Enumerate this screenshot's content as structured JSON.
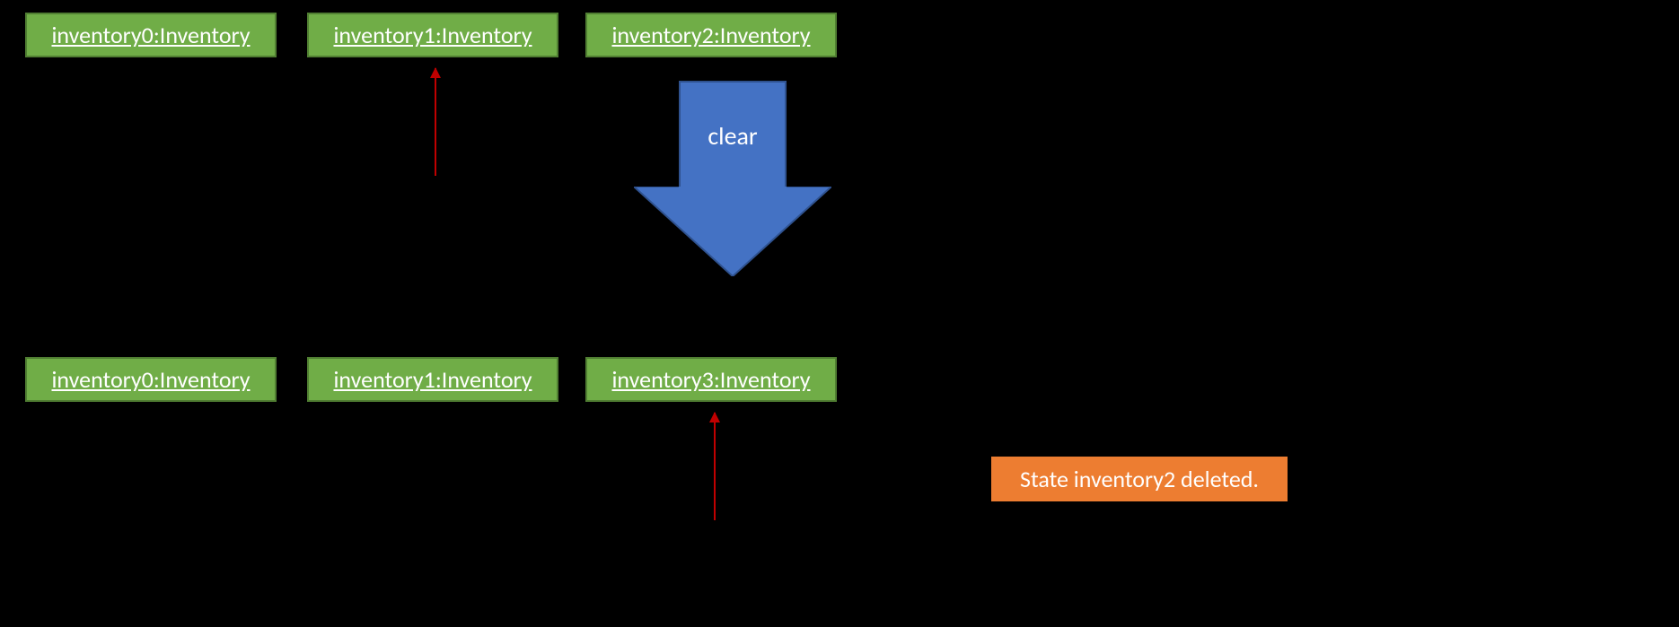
{
  "top_row": {
    "objects": [
      {
        "label": "inventory0:Inventory"
      },
      {
        "label": "inventory1:Inventory"
      },
      {
        "label": "inventory2:Inventory"
      }
    ]
  },
  "bottom_row": {
    "objects": [
      {
        "label": "inventory0:Inventory"
      },
      {
        "label": "inventory1:Inventory"
      },
      {
        "label": "inventory3:Inventory"
      }
    ]
  },
  "big_arrow": {
    "label": "clear"
  },
  "status": {
    "label": "State inventory2 deleted."
  }
}
